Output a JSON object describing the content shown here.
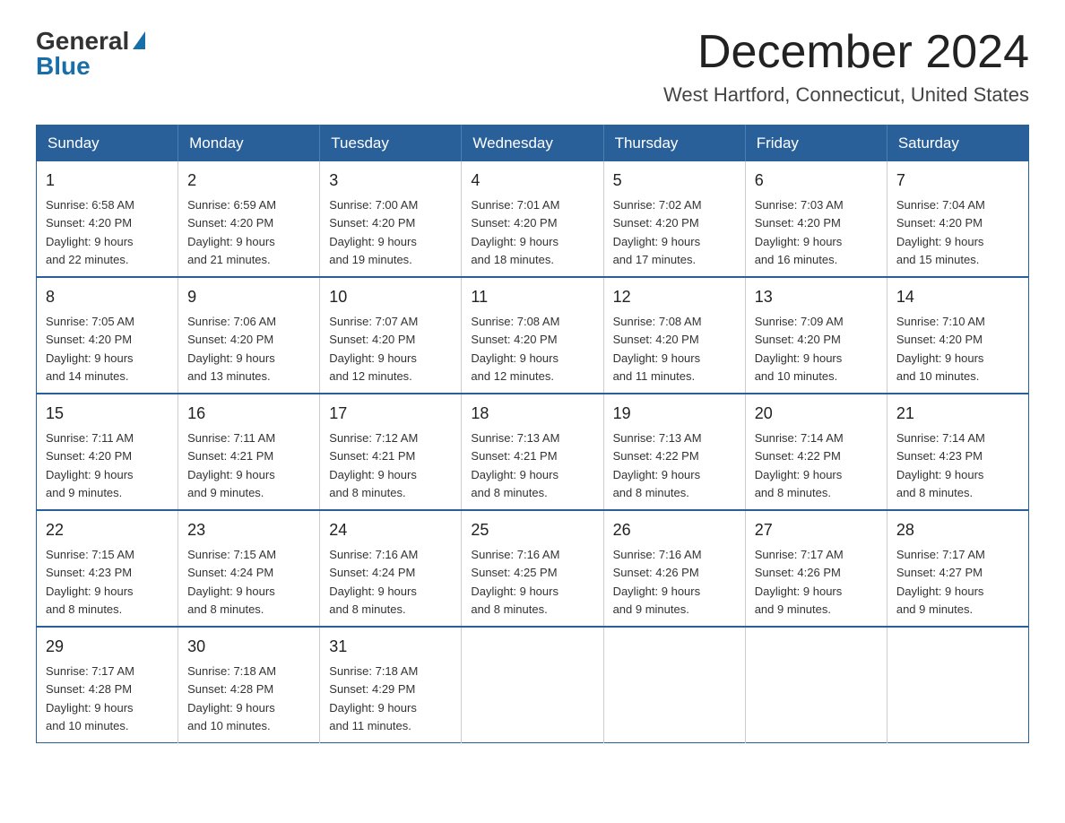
{
  "header": {
    "logo_general": "General",
    "logo_blue": "Blue",
    "month_title": "December 2024",
    "location": "West Hartford, Connecticut, United States"
  },
  "days_of_week": [
    "Sunday",
    "Monday",
    "Tuesday",
    "Wednesday",
    "Thursday",
    "Friday",
    "Saturday"
  ],
  "weeks": [
    [
      {
        "day": "1",
        "sunrise": "6:58 AM",
        "sunset": "4:20 PM",
        "daylight": "9 hours and 22 minutes."
      },
      {
        "day": "2",
        "sunrise": "6:59 AM",
        "sunset": "4:20 PM",
        "daylight": "9 hours and 21 minutes."
      },
      {
        "day": "3",
        "sunrise": "7:00 AM",
        "sunset": "4:20 PM",
        "daylight": "9 hours and 19 minutes."
      },
      {
        "day": "4",
        "sunrise": "7:01 AM",
        "sunset": "4:20 PM",
        "daylight": "9 hours and 18 minutes."
      },
      {
        "day": "5",
        "sunrise": "7:02 AM",
        "sunset": "4:20 PM",
        "daylight": "9 hours and 17 minutes."
      },
      {
        "day": "6",
        "sunrise": "7:03 AM",
        "sunset": "4:20 PM",
        "daylight": "9 hours and 16 minutes."
      },
      {
        "day": "7",
        "sunrise": "7:04 AM",
        "sunset": "4:20 PM",
        "daylight": "9 hours and 15 minutes."
      }
    ],
    [
      {
        "day": "8",
        "sunrise": "7:05 AM",
        "sunset": "4:20 PM",
        "daylight": "9 hours and 14 minutes."
      },
      {
        "day": "9",
        "sunrise": "7:06 AM",
        "sunset": "4:20 PM",
        "daylight": "9 hours and 13 minutes."
      },
      {
        "day": "10",
        "sunrise": "7:07 AM",
        "sunset": "4:20 PM",
        "daylight": "9 hours and 12 minutes."
      },
      {
        "day": "11",
        "sunrise": "7:08 AM",
        "sunset": "4:20 PM",
        "daylight": "9 hours and 12 minutes."
      },
      {
        "day": "12",
        "sunrise": "7:08 AM",
        "sunset": "4:20 PM",
        "daylight": "9 hours and 11 minutes."
      },
      {
        "day": "13",
        "sunrise": "7:09 AM",
        "sunset": "4:20 PM",
        "daylight": "9 hours and 10 minutes."
      },
      {
        "day": "14",
        "sunrise": "7:10 AM",
        "sunset": "4:20 PM",
        "daylight": "9 hours and 10 minutes."
      }
    ],
    [
      {
        "day": "15",
        "sunrise": "7:11 AM",
        "sunset": "4:20 PM",
        "daylight": "9 hours and 9 minutes."
      },
      {
        "day": "16",
        "sunrise": "7:11 AM",
        "sunset": "4:21 PM",
        "daylight": "9 hours and 9 minutes."
      },
      {
        "day": "17",
        "sunrise": "7:12 AM",
        "sunset": "4:21 PM",
        "daylight": "9 hours and 8 minutes."
      },
      {
        "day": "18",
        "sunrise": "7:13 AM",
        "sunset": "4:21 PM",
        "daylight": "9 hours and 8 minutes."
      },
      {
        "day": "19",
        "sunrise": "7:13 AM",
        "sunset": "4:22 PM",
        "daylight": "9 hours and 8 minutes."
      },
      {
        "day": "20",
        "sunrise": "7:14 AM",
        "sunset": "4:22 PM",
        "daylight": "9 hours and 8 minutes."
      },
      {
        "day": "21",
        "sunrise": "7:14 AM",
        "sunset": "4:23 PM",
        "daylight": "9 hours and 8 minutes."
      }
    ],
    [
      {
        "day": "22",
        "sunrise": "7:15 AM",
        "sunset": "4:23 PM",
        "daylight": "9 hours and 8 minutes."
      },
      {
        "day": "23",
        "sunrise": "7:15 AM",
        "sunset": "4:24 PM",
        "daylight": "9 hours and 8 minutes."
      },
      {
        "day": "24",
        "sunrise": "7:16 AM",
        "sunset": "4:24 PM",
        "daylight": "9 hours and 8 minutes."
      },
      {
        "day": "25",
        "sunrise": "7:16 AM",
        "sunset": "4:25 PM",
        "daylight": "9 hours and 8 minutes."
      },
      {
        "day": "26",
        "sunrise": "7:16 AM",
        "sunset": "4:26 PM",
        "daylight": "9 hours and 9 minutes."
      },
      {
        "day": "27",
        "sunrise": "7:17 AM",
        "sunset": "4:26 PM",
        "daylight": "9 hours and 9 minutes."
      },
      {
        "day": "28",
        "sunrise": "7:17 AM",
        "sunset": "4:27 PM",
        "daylight": "9 hours and 9 minutes."
      }
    ],
    [
      {
        "day": "29",
        "sunrise": "7:17 AM",
        "sunset": "4:28 PM",
        "daylight": "9 hours and 10 minutes."
      },
      {
        "day": "30",
        "sunrise": "7:18 AM",
        "sunset": "4:28 PM",
        "daylight": "9 hours and 10 minutes."
      },
      {
        "day": "31",
        "sunrise": "7:18 AM",
        "sunset": "4:29 PM",
        "daylight": "9 hours and 11 minutes."
      },
      null,
      null,
      null,
      null
    ]
  ],
  "labels": {
    "sunrise": "Sunrise:",
    "sunset": "Sunset:",
    "daylight": "Daylight:"
  }
}
